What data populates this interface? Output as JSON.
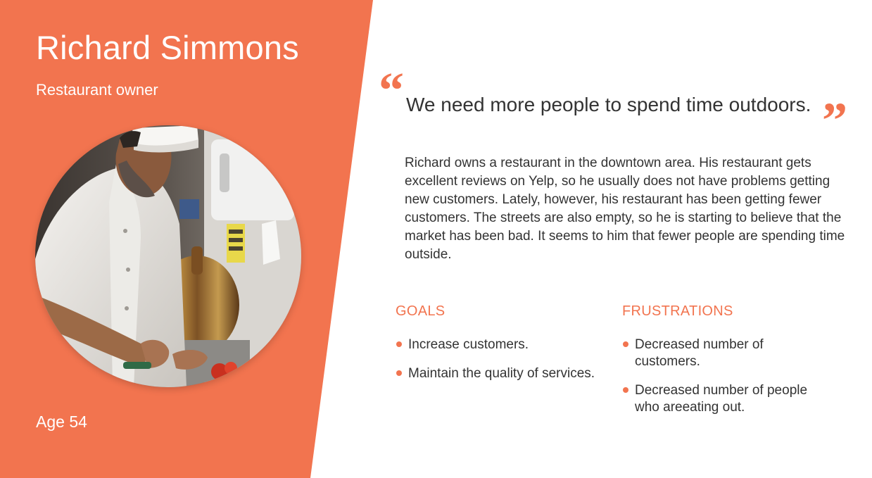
{
  "colors": {
    "accent": "#F2744F",
    "text_dark": "#333333",
    "text_on_accent": "#FFFFFF",
    "background": "#FFFFFF"
  },
  "persona": {
    "name": "Richard Simmons",
    "role": "Restaurant owner",
    "age_label": "Age 54",
    "photo_icon": "chef-portrait-photo"
  },
  "quote": {
    "open_mark": "“",
    "text": "We need more people to spend time outdoors.",
    "close_mark": "”"
  },
  "bio": "Richard owns a restaurant in the downtown area. His restaurant gets excellent reviews on Yelp, so he usually does not have problems getting new customers. Lately, however, his restaurant has been getting fewer customers. The streets are also empty, so he is starting to believe that the market has been bad. It seems to him that fewer people are spending time outside.",
  "goals": {
    "heading": "GOALS",
    "items": [
      "Increase customers.",
      "Maintain the quality of services."
    ]
  },
  "frustrations": {
    "heading": "FRUSTRATIONS",
    "items": [
      "Decreased number of customers.",
      "Decreased number of people who areeating out."
    ]
  }
}
